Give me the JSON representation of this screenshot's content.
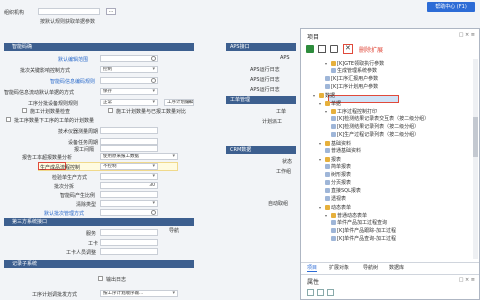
{
  "left": {
    "org_label": "组织机构",
    "org_value": "",
    "more_btn": "...",
    "pick_hint": "按默认规则获取单据参数",
    "sections": {
      "basic": "智能码确",
      "third_party": "第三方系统接口",
      "records": "记录子系统"
    },
    "rows": [
      {
        "label": "默认编辑范围",
        "value": "",
        "type": "search",
        "link": true
      },
      {
        "label": "批次关键影响控制方式",
        "value": "控制",
        "type": "select"
      },
      {
        "label": "",
        "value": "",
        "type": "search"
      },
      {
        "label": "智能码信息流动默认单据的方式",
        "value": "保存",
        "type": "select"
      },
      {
        "label": "工序分批设备规则规则",
        "value": "正常",
        "type": "select",
        "extra": "工序计划编辑-清单..."
      },
      {
        "label": "",
        "value": "",
        "type": "check",
        "extra": "施工计划数量与已报工数量对比"
      },
      {
        "label": "批工序数量下工序的工单的计划数量",
        "value": "",
        "type": "check"
      },
      {
        "label": "技术仪器测量周期",
        "value": "",
        "type": "input"
      },
      {
        "label": "设备任务周期",
        "value": "",
        "type": "input"
      },
      {
        "label": "报工间隔",
        "value": "",
        "type": "input"
      },
      {
        "label": "报告工本超报数量分析",
        "value": "使用原来报工数据",
        "type": "select"
      },
      {
        "label": "生产成品流程控制",
        "value": "不控制",
        "type": "select"
      },
      {
        "label": "检验单生产方式",
        "value": "",
        "type": "select"
      },
      {
        "label": "批次分拆",
        "value": "",
        "type": "input",
        "num": "30"
      },
      {
        "label": "",
        "value": "",
        "type": "input"
      },
      {
        "label": "清除类型",
        "value": "",
        "type": "select"
      },
      {
        "label": "默认批次管理方式",
        "value": "",
        "type": "search",
        "link": true
      }
    ],
    "third_rows": [
      {
        "label": "服务",
        "value": "",
        "btn": "导航"
      },
      {
        "label": "工卡",
        "value": ""
      },
      {
        "label": "工卡人员调整",
        "value": ""
      }
    ],
    "record_rows": [
      {
        "label": "",
        "check": "输出日志"
      },
      {
        "label": "工序计划调批发方式",
        "value": "按工序计划顺序输..."
      }
    ],
    "right_col": [
      "APS接口",
      "APS",
      "APS运行日志",
      "APS运行日志",
      "APS运行日志",
      "工单管理",
      "工单",
      "计划派工",
      "CRM数据",
      "状态",
      "工作组",
      "自动取组"
    ]
  },
  "help_button": "帮助中心 (F1)",
  "dialog": {
    "title": "项目",
    "note": "删除扩展",
    "window_controls": "□ × ≡",
    "tree": [
      {
        "label": "[K]GTE领取执行参数",
        "level": 3,
        "icon": "folder",
        "expand": "▾"
      },
      {
        "label": "生成管理系统参数",
        "level": 4,
        "icon": "doc",
        "selected": true
      },
      {
        "label": "[K]工序汇报用户参数",
        "level": 3,
        "icon": "doc"
      },
      {
        "label": "[K]工序计划用户参数",
        "level": 3,
        "icon": "doc"
      },
      {
        "label": "数据",
        "level": 1,
        "icon": "folder",
        "expand": "▾"
      },
      {
        "label": "单据",
        "level": 2,
        "icon": "folder",
        "expand": "▾"
      },
      {
        "label": "工序过程控制打印",
        "level": 3,
        "icon": "folder",
        "expand": "▾"
      },
      {
        "label": "[K]检测结果记录表交互表（按二级分组）",
        "level": 4,
        "icon": "doc"
      },
      {
        "label": "[K]检测结果记录列表（按二级分组）",
        "level": 4,
        "icon": "doc"
      },
      {
        "label": "[K]生产过程记录列表（按二级分组）",
        "level": 4,
        "icon": "doc"
      },
      {
        "label": "基础资料",
        "level": 2,
        "icon": "folder",
        "expand": "▾"
      },
      {
        "label": "普通基础资料",
        "level": 3,
        "icon": "doc"
      },
      {
        "label": "报表",
        "level": 2,
        "icon": "folder",
        "expand": "▾"
      },
      {
        "label": "简单报表",
        "level": 3,
        "icon": "doc"
      },
      {
        "label": "树形报表",
        "level": 3,
        "icon": "doc"
      },
      {
        "label": "分页报表",
        "level": 3,
        "icon": "doc"
      },
      {
        "label": "直接SQL报表",
        "level": 3,
        "icon": "doc"
      },
      {
        "label": "透视表",
        "level": 3,
        "icon": "doc"
      },
      {
        "label": "动态表单",
        "level": 2,
        "icon": "folder",
        "expand": "▾"
      },
      {
        "label": "普通动态表单",
        "level": 3,
        "icon": "folder",
        "expand": "▾"
      },
      {
        "label": "单件产品加工过程查询",
        "level": 4,
        "icon": "doc"
      },
      {
        "label": "[K]单件产品跟踪-加工过程",
        "level": 4,
        "icon": "doc"
      },
      {
        "label": "[K]单件产品查询-加工过程",
        "level": 4,
        "icon": "doc"
      }
    ],
    "tabs": [
      "项目",
      "扩展对象",
      "导航树",
      "数据库"
    ],
    "props_title": "属性"
  }
}
